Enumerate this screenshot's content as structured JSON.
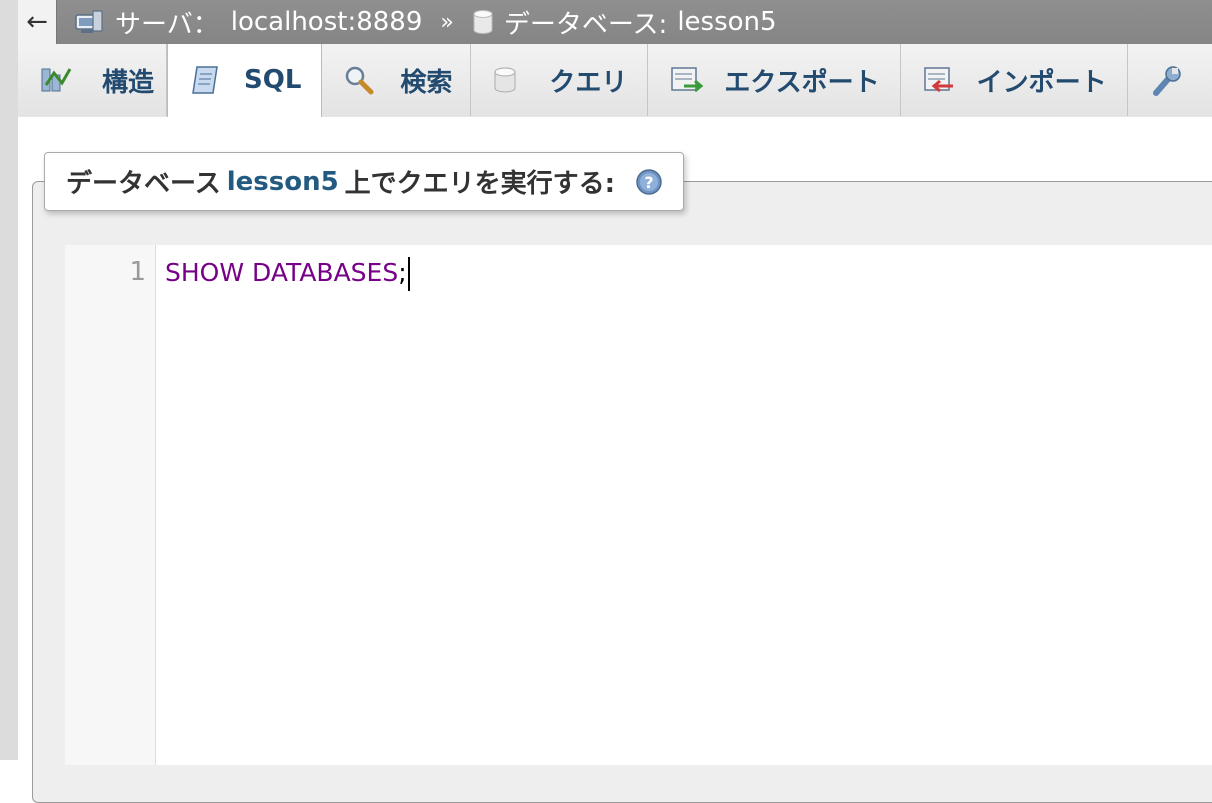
{
  "topbar": {
    "back": "←",
    "server_label": "サーバ：",
    "server_value": "localhost:8889",
    "separator": "»",
    "database_label": "データベース:",
    "database_value": "lesson5"
  },
  "tabs": [
    {
      "label": "構造",
      "icon": "structure-icon",
      "active": false
    },
    {
      "label": "SQL",
      "icon": "sql-icon",
      "active": true
    },
    {
      "label": "検索",
      "icon": "search-icon",
      "active": false
    },
    {
      "label": "クエリ",
      "icon": "query-icon",
      "active": false
    },
    {
      "label": "エクスポート",
      "icon": "export-icon",
      "active": false
    },
    {
      "label": "インポート",
      "icon": "import-icon",
      "active": false
    },
    {
      "label": "",
      "icon": "wrench-icon",
      "active": false
    }
  ],
  "query_box": {
    "legend_prefix": "データベース",
    "legend_db": "lesson5",
    "legend_suffix": "上でクエリを実行する:"
  },
  "editor": {
    "line_numbers": [
      "1"
    ],
    "code_keyword": "SHOW DATABASES",
    "code_punct": ";"
  },
  "colors": {
    "topbar": "#888888",
    "tab_text": "#234a6f",
    "legend_db": "#235a81",
    "sql_keyword": "#770088"
  }
}
